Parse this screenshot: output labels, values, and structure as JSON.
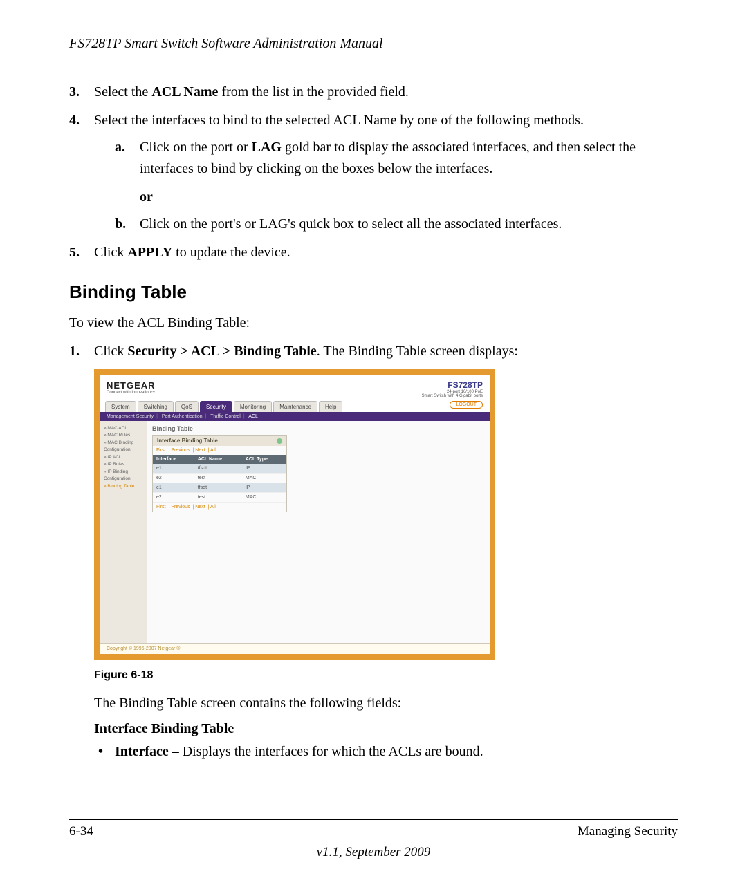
{
  "header": {
    "title": "FS728TP Smart Switch Software Administration Manual"
  },
  "steps": {
    "s3_num": "3.",
    "s3_pre": "Select the ",
    "s3_bold": "ACL Name",
    "s3_post": " from the list in the provided field.",
    "s4_num": "4.",
    "s4_text": "Select the interfaces to bind to the selected ACL Name by one of the following methods.",
    "s4a_letter": "a.",
    "s4a_pre": "Click on the port or ",
    "s4a_bold": "LAG",
    "s4a_post": " gold bar to display the associated interfaces, and then select the interfaces to bind by clicking on the boxes below the interfaces.",
    "or": "or",
    "s4b_letter": "b.",
    "s4b_text": "Click on the port's or LAG's quick box to select all the associated interfaces.",
    "s5_num": "5.",
    "s5_pre": "Click ",
    "s5_bold": "APPLY",
    "s5_post": " to update the device."
  },
  "section": {
    "heading": "Binding Table",
    "intro": "To view the ACL Binding Table:",
    "step1_num": "1.",
    "step1_pre": "Click ",
    "step1_bold": "Security > ACL > Binding Table",
    "step1_post": ". The Binding Table screen displays:"
  },
  "screenshot": {
    "brand": "NETGEAR",
    "brand_tag": "Connect with Innovation™",
    "model": "FS728TP",
    "model_desc1": "24-port 10/100 PoE",
    "model_desc2": "Smart Switch with 4 Gigabit ports",
    "tabs": [
      "System",
      "Switching",
      "QoS",
      "Security",
      "Monitoring",
      "Maintenance",
      "Help"
    ],
    "active_tab": "Security",
    "logout": "LOGOUT",
    "subnav": {
      "items": [
        "Management Security",
        "Port Authentication",
        "Traffic Control",
        "ACL"
      ],
      "active": "ACL"
    },
    "side": [
      "» MAC ACL",
      "» MAC Rules",
      "» MAC Binding",
      "  Configuration",
      "» IP ACL",
      "» IP Rules",
      "» IP Binding",
      "  Configuration",
      "» Binding Table"
    ],
    "panel_title": "Binding Table",
    "panel_head": "Interface Binding Table",
    "pager": [
      "First",
      "Previous",
      "Next",
      "All"
    ],
    "cols": [
      "Interface",
      "ACL Name",
      "ACL Type"
    ],
    "rows": [
      {
        "iface": "e1",
        "name": "tfsdt",
        "type": "IP"
      },
      {
        "iface": "e2",
        "name": "test",
        "type": "MAC"
      },
      {
        "iface": "e1",
        "name": "tfsdt",
        "type": "IP"
      },
      {
        "iface": "e2",
        "name": "test",
        "type": "MAC"
      }
    ],
    "copyright": "Copyright © 1996-2007 Netgear ®"
  },
  "figure_caption": "Figure 6-18",
  "after_fig": {
    "para": "The Binding Table screen contains the following fields:",
    "sub_title": "Interface Binding Table",
    "bullet_bold": "Interface",
    "bullet_rest": " – Displays the interfaces for which the ACLs are bound."
  },
  "footer": {
    "page": "6-34",
    "section": "Managing Security",
    "version": "v1.1, September 2009"
  }
}
